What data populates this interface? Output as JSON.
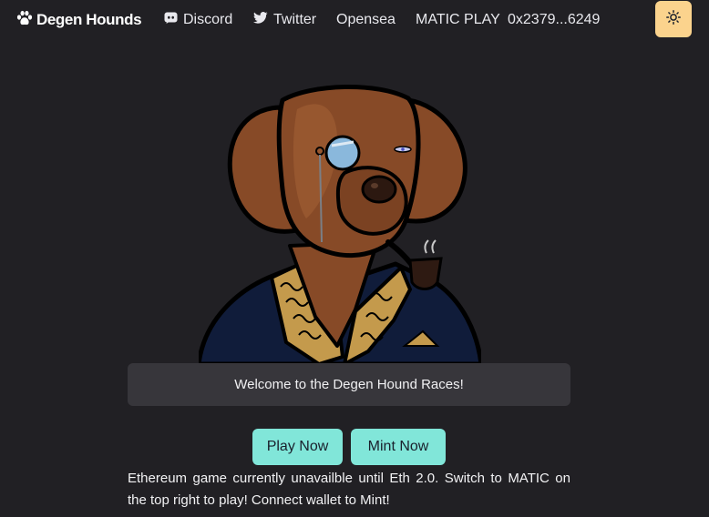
{
  "nav": {
    "brand": "Degen Hounds",
    "brand_icon": "paw-icon",
    "links": [
      {
        "label": "Discord",
        "icon": "discord-icon"
      },
      {
        "label": "Twitter",
        "icon": "twitter-icon"
      },
      {
        "label": "Opensea"
      },
      {
        "label": "MATIC PLAY"
      },
      {
        "label": "0x2379...6249"
      }
    ],
    "theme_toggle_icon": "sun-icon",
    "theme_toggle_color": "#fbd38d"
  },
  "hero": {
    "image": "hound-illustration"
  },
  "banner": {
    "text": "Welcome to the Degen Hound Races!"
  },
  "actions": {
    "play_label": "Play Now",
    "mint_label": "Mint Now",
    "button_color": "#81e6d9"
  },
  "info_text": "Ethereum game currently unavailble until Eth 2.0. Switch to MATIC on the top right to play! Connect wallet to Mint!",
  "colors": {
    "background": "#212024",
    "banner": "#37363b"
  }
}
